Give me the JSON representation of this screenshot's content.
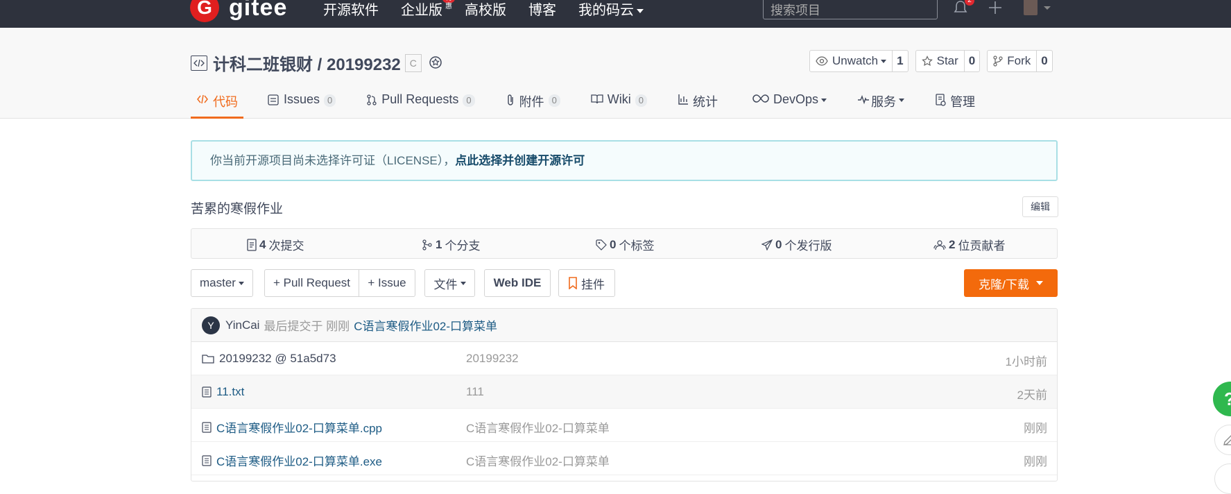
{
  "topbar": {
    "logo_mark": "G",
    "logo_text": "gitee",
    "nav": [
      {
        "label": "开源软件"
      },
      {
        "label": "企业版",
        "badge": "特惠"
      },
      {
        "label": "高校版"
      },
      {
        "label": "博客"
      },
      {
        "label": "我的码云"
      }
    ],
    "search_placeholder": "搜索项目",
    "notification_count": "2"
  },
  "project": {
    "title": "计科二班银财 / 20199232",
    "lang_tag": "C",
    "actions": {
      "watch_label": "Unwatch",
      "watch_count": "1",
      "star_label": "Star",
      "star_count": "0",
      "fork_label": "Fork",
      "fork_count": "0"
    },
    "tabs": [
      {
        "label": "代码",
        "icon": "code-icon"
      },
      {
        "label": "Issues",
        "count": "0",
        "icon": "issues-icon"
      },
      {
        "label": "Pull Requests",
        "count": "0",
        "icon": "pull-request-icon"
      },
      {
        "label": "附件",
        "count": "0",
        "icon": "paperclip-icon"
      },
      {
        "label": "Wiki",
        "count": "0",
        "icon": "book-icon"
      },
      {
        "label": "统计",
        "icon": "bar-chart-icon"
      },
      {
        "label": "DevOps",
        "icon": "infinity-icon"
      },
      {
        "label": "服务",
        "icon": "pulse-icon"
      },
      {
        "label": "管理",
        "icon": "settings-doc-icon"
      }
    ]
  },
  "license": {
    "text": "你当前开源项目尚未选择许可证（LICENSE），",
    "link": "点此选择并创建开源许可"
  },
  "description": "苦累的寒假作业",
  "edit_label": "编辑",
  "stats": {
    "commits": {
      "count": "4",
      "label": "次提交"
    },
    "branches": {
      "count": "1",
      "label": "个分支"
    },
    "tags": {
      "count": "0",
      "label": "个标签"
    },
    "releases": {
      "count": "0",
      "label": "个发行版"
    },
    "contributors": {
      "count": "2",
      "label": "位贡献者"
    }
  },
  "toolbar": {
    "branch": "master",
    "pull_request": "+ Pull Request",
    "issue": "+ Issue",
    "file": "文件",
    "web_ide": "Web IDE",
    "widget": "挂件",
    "clone": "克隆/下载"
  },
  "latest_commit": {
    "avatar_letter": "Y",
    "author": "YinCai",
    "meta": "最后提交于 刚刚",
    "message": "C语言寒假作业02-口算菜单"
  },
  "files": [
    {
      "name": "20199232 @ 51a5d73",
      "type": "folder",
      "message": "20199232",
      "time": "1小时前"
    },
    {
      "name": "11.txt",
      "type": "file",
      "message": "111",
      "time": "2天前"
    },
    {
      "name": "C语言寒假作业02-口算菜单.cpp",
      "type": "file",
      "message": "C语言寒假作业02-口算菜单",
      "time": "刚刚"
    },
    {
      "name": "C语言寒假作业02-口算菜单.exe",
      "type": "file",
      "message": "C语言寒假作业02-口算菜单",
      "time": "刚刚"
    }
  ],
  "side": {
    "help": "?"
  },
  "colors": {
    "topbar": "#2e323d",
    "accent": "#f06b1d",
    "clone_button": "#f36a0c",
    "link": "#1d5b84",
    "help_button": "#2fb84e"
  }
}
